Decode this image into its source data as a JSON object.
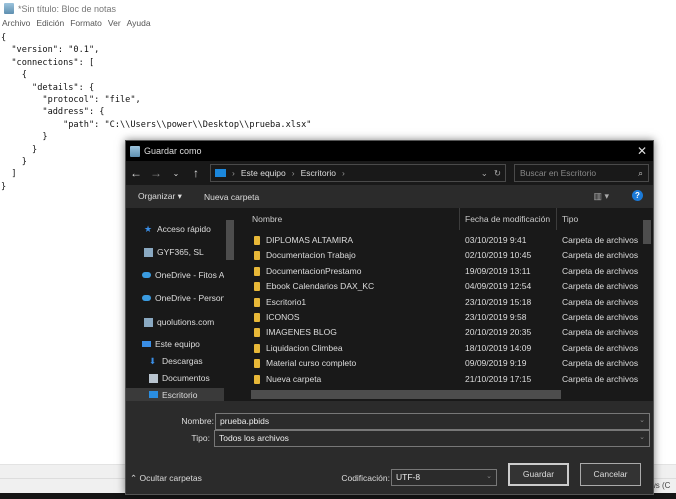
{
  "notepad": {
    "title": "*Sin título: Bloc de notas",
    "menu": [
      "Archivo",
      "Edición",
      "Formato",
      "Ver",
      "Ayuda"
    ],
    "content": "{\n  \"version\": \"0.1\",\n  \"connections\": [\n    {\n      \"details\": {\n        \"protocol\": \"file\",\n        \"address\": {\n            \"path\": \"C:\\\\Users\\\\power\\\\Desktop\\\\prueba.xlsx\"\n        }\n      }\n    }\n  ]\n}",
    "status_fragment": "ws (C"
  },
  "dialog": {
    "title": "Guardar como",
    "breadcrumb": [
      "Este equipo",
      "Escritorio"
    ],
    "search_placeholder": "Buscar en Escritorio",
    "organize": "Organizar ▾",
    "new_folder": "Nueva carpeta",
    "nav": [
      {
        "label": "Acceso rápido",
        "icon": "star-icon"
      },
      {
        "label": "GYF365, SL",
        "icon": "building-icon"
      },
      {
        "label": "OneDrive - Fitos A",
        "icon": "cloud-icon"
      },
      {
        "label": "OneDrive - Person",
        "icon": "cloud-icon"
      },
      {
        "label": "quolutions.com",
        "icon": "building-icon"
      },
      {
        "label": "Este equipo",
        "icon": "computer-icon"
      },
      {
        "label": "Descargas",
        "icon": "download-icon"
      },
      {
        "label": "Documentos",
        "icon": "document-icon"
      },
      {
        "label": "Escritorio",
        "icon": "desktop-icon"
      }
    ],
    "columns": {
      "name": "Nombre",
      "date": "Fecha de modificación",
      "type": "Tipo"
    },
    "files": [
      {
        "name": "DIPLOMAS ALTAMIRA",
        "date": "03/10/2019 9:41",
        "type": "Carpeta de archivos"
      },
      {
        "name": "Documentacion Trabajo",
        "date": "02/10/2019 10:45",
        "type": "Carpeta de archivos"
      },
      {
        "name": "DocumentacionPrestamo",
        "date": "19/09/2019 13:11",
        "type": "Carpeta de archivos"
      },
      {
        "name": "Ebook Calendarios DAX_KC",
        "date": "04/09/2019 12:54",
        "type": "Carpeta de archivos"
      },
      {
        "name": "Escritorio1",
        "date": "23/10/2019 15:18",
        "type": "Carpeta de archivos"
      },
      {
        "name": "ICONOS",
        "date": "23/10/2019 9:58",
        "type": "Carpeta de archivos"
      },
      {
        "name": "IMAGENES BLOG",
        "date": "20/10/2019 20:35",
        "type": "Carpeta de archivos"
      },
      {
        "name": "Liquidacion Climbea",
        "date": "18/10/2019 14:09",
        "type": "Carpeta de archivos"
      },
      {
        "name": "Material curso completo",
        "date": "09/09/2019 9:19",
        "type": "Carpeta de archivos"
      },
      {
        "name": "Nueva carpeta",
        "date": "21/10/2019 17:15",
        "type": "Carpeta de archivos"
      }
    ],
    "filename_label": "Nombre:",
    "filename": "prueba.pbids",
    "type_label": "Tipo:",
    "type_value": "Todos los archivos",
    "hide_folders": "Ocultar carpetas",
    "encoding_label": "Codificación:",
    "encoding": "UTF-8",
    "save": "Guardar",
    "cancel": "Cancelar"
  }
}
